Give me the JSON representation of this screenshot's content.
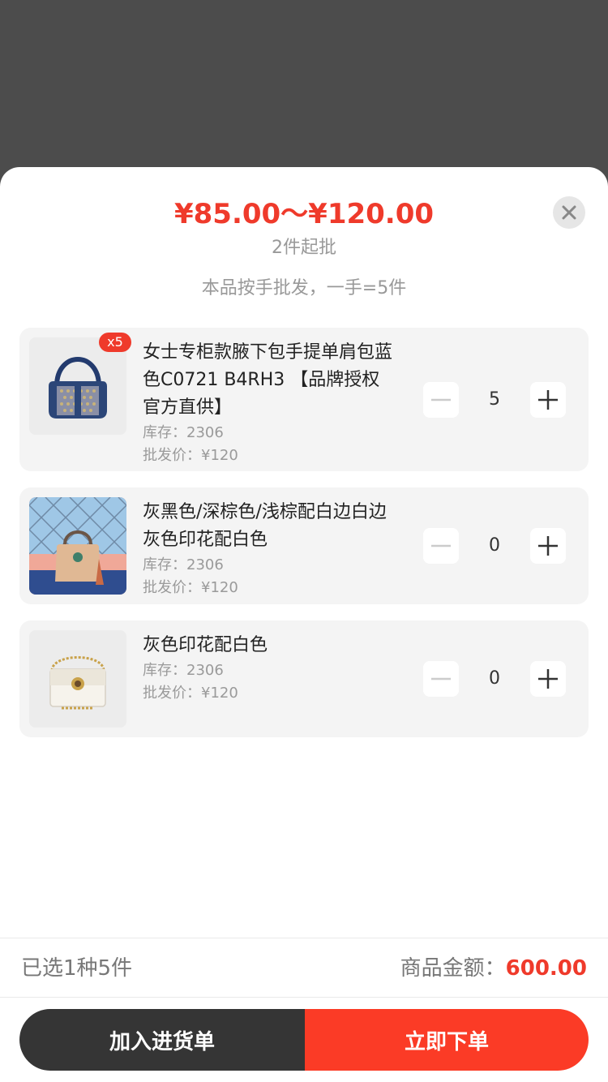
{
  "header": {
    "price_range": "¥85.00～¥120.00",
    "min_order": "2件起批",
    "lot_note": "本品按手批发，一手=5件",
    "close_icon": "close-icon"
  },
  "items": [
    {
      "badge": "x5",
      "name": "女士专柜款腋下包手提单肩包蓝色C0721 B4RH3 【品牌授权 官方直供】",
      "stock": "库存：2306",
      "price": "批发价：¥120",
      "qty": "5",
      "thumb_icon": "navy-shoulder-bag-image"
    },
    {
      "name": "灰黑色/深棕色/浅棕配白边白边灰色印花配白色",
      "stock": "库存：2306",
      "price": "批发价：¥120",
      "qty": "0",
      "thumb_icon": "tan-handbag-fence-image"
    },
    {
      "name": "灰色印花配白色",
      "stock": "库存：2306",
      "price": "批发价：¥120",
      "qty": "0",
      "thumb_icon": "white-chain-bag-image"
    }
  ],
  "summary": {
    "selected": "已选1种5件",
    "total_label": "商品金额：",
    "total_value": "600.00"
  },
  "actions": {
    "add_to_cart": "加入进货单",
    "order_now": "立即下单"
  },
  "colors": {
    "accent": "#ef3a2b",
    "dark_button": "#353535",
    "order_button": "#fb3b26"
  }
}
